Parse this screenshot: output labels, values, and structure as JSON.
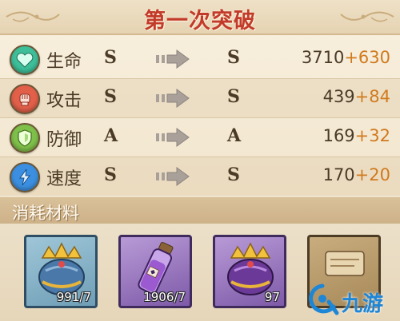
{
  "title": "第一次突破",
  "stats": [
    {
      "icon": "heart-icon",
      "label": "生命",
      "grade_before": "S",
      "grade_after": "S",
      "base": "3710",
      "bonus": "+630",
      "color": "#3dbf9a"
    },
    {
      "icon": "fist-icon",
      "label": "攻击",
      "grade_before": "S",
      "grade_after": "S",
      "base": "439",
      "bonus": "+84",
      "color": "#e2604a"
    },
    {
      "icon": "shield-icon",
      "label": "防御",
      "grade_before": "A",
      "grade_after": "A",
      "base": "169",
      "bonus": "+32",
      "color": "#7fc04a"
    },
    {
      "icon": "lightning-icon",
      "label": "速度",
      "grade_before": "S",
      "grade_after": "S",
      "base": "170",
      "bonus": "+20",
      "color": "#3c8fe0"
    }
  ],
  "materials": {
    "header": "消耗材料",
    "items": [
      {
        "icon": "blue-crown-icon",
        "count": "991/7",
        "rarity_color": "#6f9eb6"
      },
      {
        "icon": "purple-potion-icon",
        "count": "1906/7",
        "rarity_color": "#7e5aa8"
      },
      {
        "icon": "purple-crown-icon",
        "count": "97",
        "rarity_color": "#7e5aa8"
      },
      {
        "icon": "scroll-item-icon",
        "count": "",
        "rarity_color": "#a88a5a"
      }
    ]
  },
  "watermark": {
    "text": "九游",
    "icon": "jiuyou-logo-icon"
  }
}
